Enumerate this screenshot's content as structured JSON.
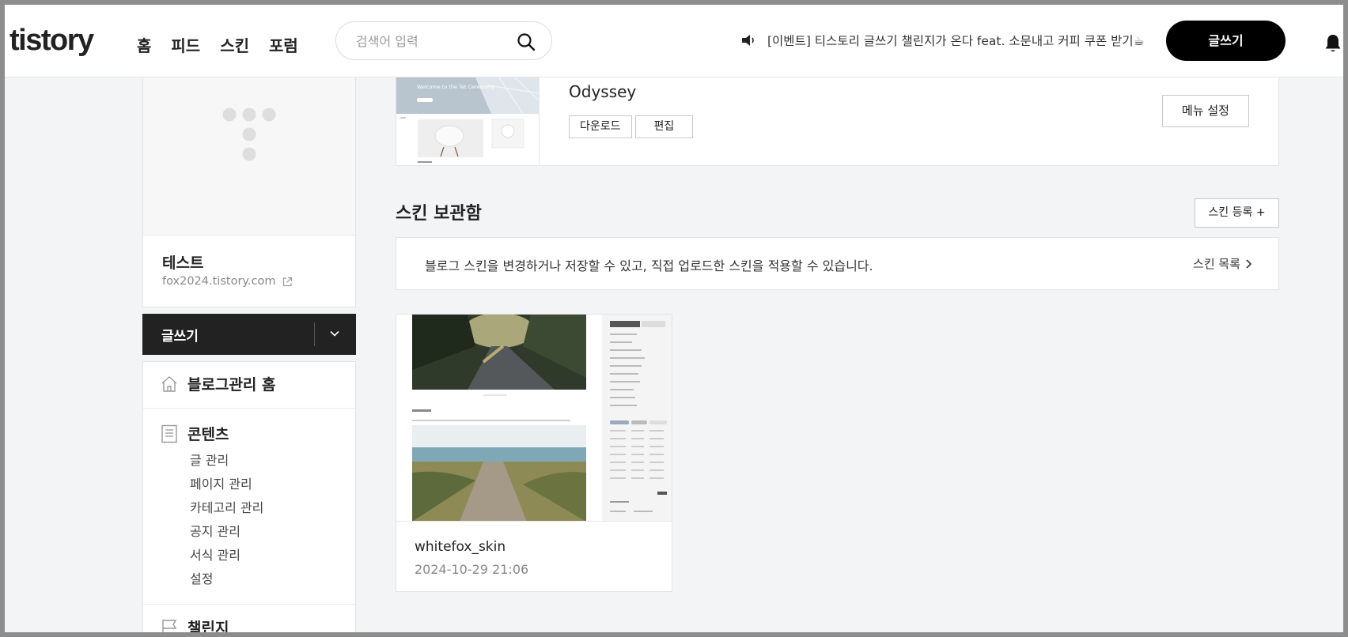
{
  "header": {
    "logo": "tistory",
    "nav": [
      "홈",
      "피드",
      "스킨",
      "포럼"
    ],
    "search_placeholder": "검색어 입력",
    "notice": "[이벤트] 티스토리 글쓰기 챌린지가 온다 feat. 소문내고 커피 쿠폰 받기☕",
    "write_label": "글쓰기"
  },
  "sidebar": {
    "blog_name": "테스트",
    "blog_url": "fox2024.tistory.com",
    "write_label": "글쓰기",
    "menu_home": "블로그관리 홈",
    "menu_contents": "콘텐츠",
    "contents_items": [
      "글 관리",
      "페이지 관리",
      "카테고리 관리",
      "공지 관리",
      "서식 관리",
      "설정"
    ],
    "menu_challenge": "챌린지"
  },
  "current_skin": {
    "name": "Odyssey",
    "download_label": "다운로드",
    "edit_label": "편집",
    "menu_setting_label": "메뉴 설정",
    "thumb_text": "Welcome to the Tet Ceremony"
  },
  "skin_storage": {
    "title": "스킨 보관함",
    "register_label": "스킨 등록 +",
    "info_text": "블로그 스킨을 변경하거나 저장할 수 있고, 직접 업로드한 스킨을 적용할 수 있습니다.",
    "list_link": "스킨 목록",
    "items": [
      {
        "name": "whitefox_skin",
        "date": "2024-10-29 21:06"
      }
    ]
  },
  "colors": {
    "accent": "#000000",
    "page_bg": "#f3f4f6",
    "sidebar_write_bg": "#222222"
  }
}
